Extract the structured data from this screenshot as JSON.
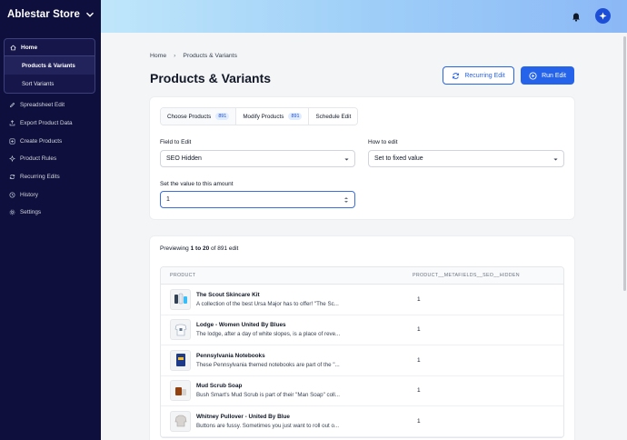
{
  "sidebar": {
    "brand": "Ablestar Store",
    "home_label": "Home",
    "sub_items": [
      {
        "label": "Products & Variants"
      },
      {
        "label": "Sort Variants"
      }
    ],
    "items": [
      {
        "label": "Spreadsheet Edit",
        "icon": "pencil-icon"
      },
      {
        "label": "Export Product Data",
        "icon": "export-icon"
      },
      {
        "label": "Create Products",
        "icon": "plus-square-icon"
      },
      {
        "label": "Product Rules",
        "icon": "sparkle-icon"
      },
      {
        "label": "Recurring Edits",
        "icon": "refresh-icon"
      },
      {
        "label": "History",
        "icon": "clock-icon"
      },
      {
        "label": "Settings",
        "icon": "gear-icon"
      }
    ]
  },
  "breadcrumb": {
    "home": "Home",
    "current": "Products & Variants"
  },
  "page_title": "Products & Variants",
  "actions": {
    "recurring": "Recurring Edit",
    "run": "Run Edit"
  },
  "tabs": [
    {
      "label": "Choose Products",
      "count": "891"
    },
    {
      "label": "Modify Products",
      "count": "891"
    },
    {
      "label": "Schedule Edit",
      "count": ""
    }
  ],
  "form": {
    "field_label": "Field to Edit",
    "field_value": "SEO Hidden",
    "how_label": "How to edit",
    "how_value": "Set to fixed value",
    "amount_label": "Set the value to this amount",
    "amount_value": "1"
  },
  "preview": {
    "prefix": "Previewing ",
    "range": "1 to 20",
    "suffix": " of 891 edit"
  },
  "table": {
    "columns": [
      "PRODUCT",
      "PRODUCT__METAFIELDS__SEO__HIDDEN"
    ],
    "rows": [
      {
        "name": "The Scout Skincare Kit",
        "desc": "A collection of the best Ursa Major has to offer! \"The Sc...",
        "value": "1"
      },
      {
        "name": "Lodge - Women United By Blues",
        "desc": "The lodge, after a day of white slopes, is a place of reve...",
        "value": "1"
      },
      {
        "name": "Pennsylvania Notebooks",
        "desc": "These Pennsylvania themed notebooks are part of the \"...",
        "value": "1"
      },
      {
        "name": "Mud Scrub Soap",
        "desc": "Bush Smart's Mud Scrub is part of their \"Man Soap\" coll...",
        "value": "1"
      },
      {
        "name": "Whitney Pullover - United By Blue",
        "desc": "Buttons are fussy. Sometimes you just want to roll out o...",
        "value": "1"
      }
    ]
  },
  "colors": {
    "sidebar": "#0f0f3d",
    "accent": "#2563eb"
  }
}
